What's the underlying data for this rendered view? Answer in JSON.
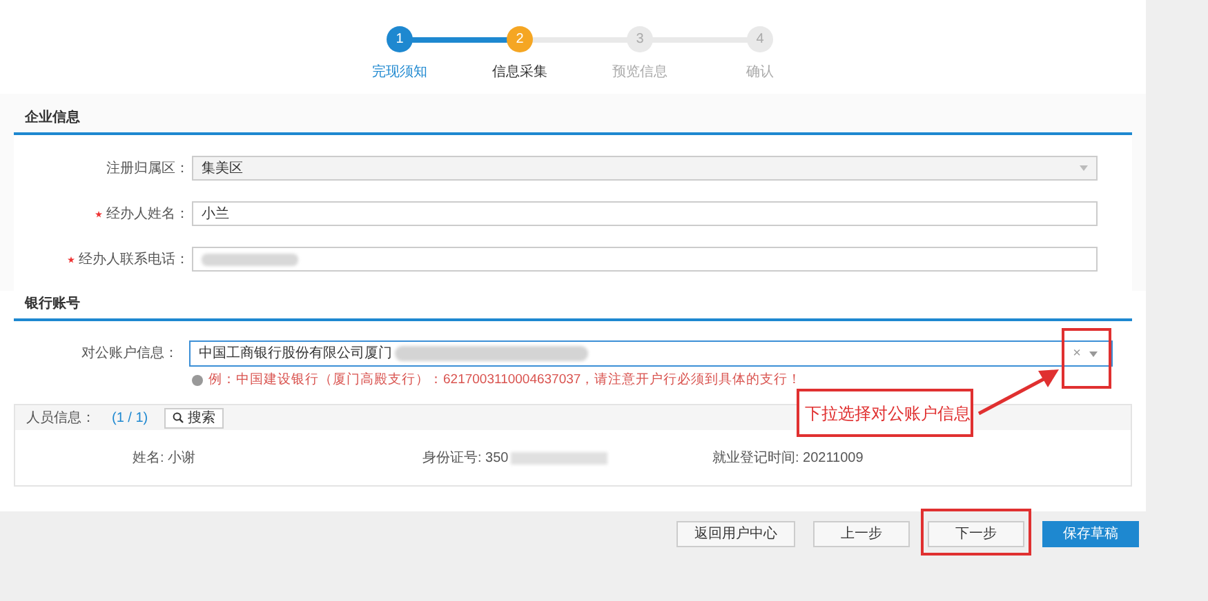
{
  "steps": [
    {
      "number": "1",
      "label": "完现须知",
      "completed": true,
      "selected": false
    },
    {
      "number": "2",
      "label": "信息采集",
      "completed": false,
      "selected": true
    },
    {
      "number": "3",
      "label": "预览信息",
      "completed": false,
      "selected": false
    },
    {
      "number": "4",
      "label": "确认",
      "completed": false,
      "selected": false
    }
  ],
  "company_section": {
    "title": "企业信息",
    "fields": [
      {
        "label": "注册归属区：",
        "required": false,
        "kind": "select",
        "value": "集美区"
      },
      {
        "label": "经办人姓名：",
        "required": true,
        "kind": "text",
        "value": "小兰"
      },
      {
        "label": "经办人联系电话：",
        "required": true,
        "kind": "redacted"
      }
    ]
  },
  "bank_section": {
    "title": "银行账号",
    "label": "对公账户信息：",
    "value": "中国工商银行股份有限公司厦门",
    "clear": "×",
    "hint": "例：中国建设银行（厦门高殿支行）：6217003110004637037，请注意开户行必须到具体的支行！"
  },
  "personnel": {
    "label": "人员信息：",
    "count": "(1 / 1)",
    "search_button": "搜索",
    "name": "姓名: 小谢",
    "id_number": "身份证号: 350",
    "employment_date": "就业登记时间: 20211009"
  },
  "buttons": [
    {
      "label": "返回用户中心",
      "primary": false,
      "highlighted": false
    },
    {
      "label": "上一步",
      "primary": false,
      "highlighted": false
    },
    {
      "label": "下一步",
      "primary": false,
      "highlighted": true
    },
    {
      "label": "保存草稿",
      "primary": true,
      "highlighted": false
    }
  ],
  "annotation": {
    "text": "下拉选择对公账户信息"
  }
}
